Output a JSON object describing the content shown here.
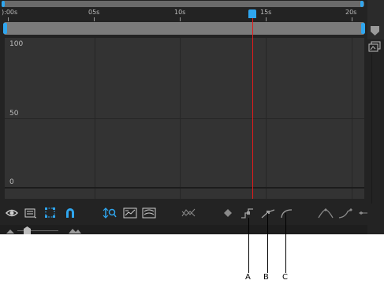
{
  "timeline": {
    "time_labels": [
      "):00s",
      "05s",
      "10s",
      "15s",
      "20s"
    ],
    "current_time_label": "15s"
  },
  "graph": {
    "y_labels": [
      "100",
      "50",
      "0"
    ]
  },
  "toolbar": {
    "icons": [
      "eye-icon",
      "graph-type-menu-icon",
      "transform-box-icon",
      "snap-icon",
      "fit-selection-icon",
      "fit-all-icon",
      "zoom-fit-icon",
      "separate-dimensions-icon",
      "edit-keyframe-icon",
      "hold-keyframe-icon",
      "linear-keyframe-icon",
      "auto-bezier-icon",
      "easy-ease-icon",
      "easy-ease-in-icon",
      "easy-ease-out-icon"
    ]
  },
  "callouts": {
    "a": "A",
    "b": "B",
    "c": "C"
  },
  "colors": {
    "panel_bg": "#232323",
    "graph_bg": "#333333",
    "accent_blue": "#2fa6ef",
    "playhead_red": "#e21b1b"
  }
}
